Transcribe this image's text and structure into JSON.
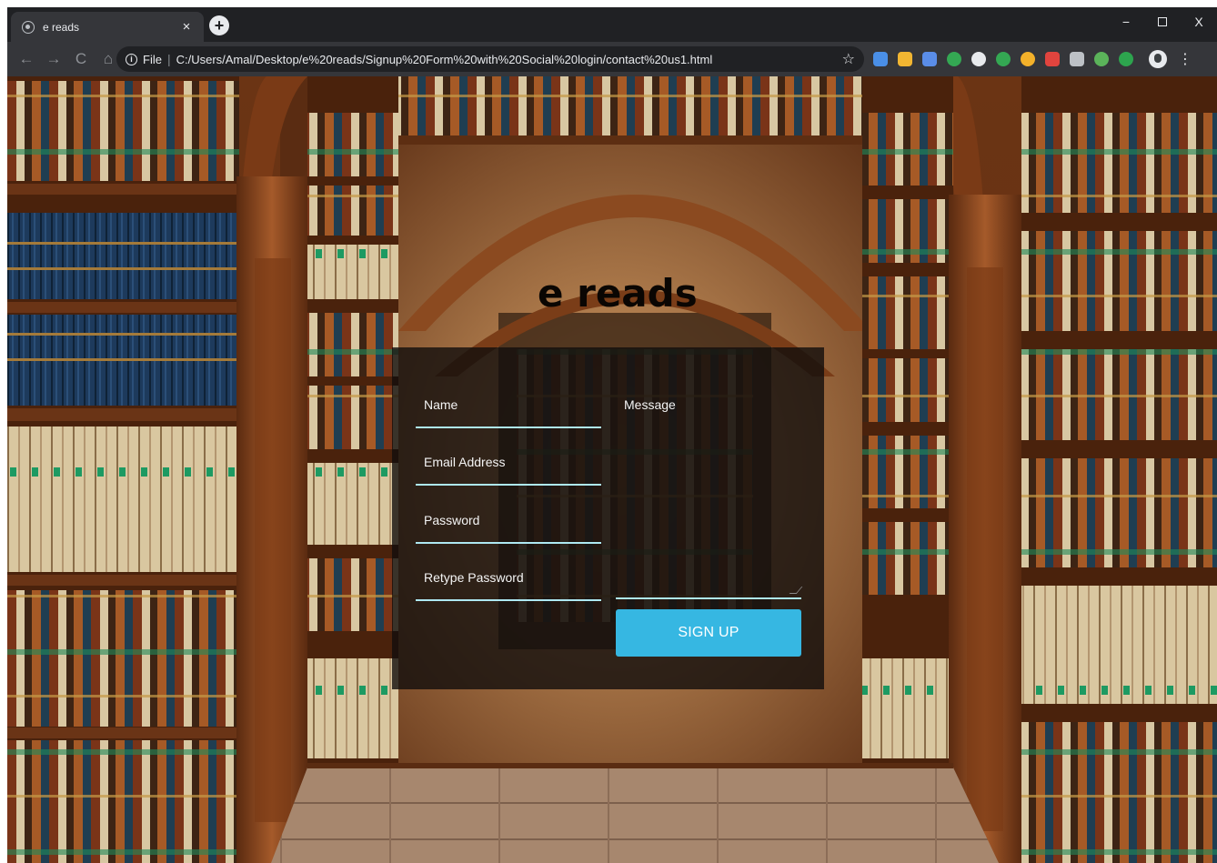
{
  "browser": {
    "tab": {
      "title": "e reads"
    },
    "address_bar": {
      "scheme": "File",
      "separator": "|",
      "url": "C:/Users/Amal/Desktop/e%20reads/Signup%20Form%20with%20Social%20login/contact%20us1.html"
    },
    "icons": {
      "tab_close": "×",
      "new_tab": "+",
      "back": "←",
      "forward": "→",
      "reload": "C",
      "home": "⌂",
      "info": "i",
      "bookmark_star": "☆",
      "menu": "⋮",
      "minimize": "−",
      "close": "X"
    },
    "extension_colors": [
      "#4a8fe7",
      "#f2b632",
      "#5a8de8",
      "#34a853",
      "#e8eaed",
      "#34a853",
      "#f3b12a",
      "#e1443e",
      "#bdc1c6",
      "#5bb35a",
      "#2da44e"
    ]
  },
  "page": {
    "brand": "e reads",
    "form": {
      "name_label": "Name",
      "email_label": "Email Address",
      "password_label": "Password",
      "retype_password_label": "Retype Password",
      "message_label": "Message",
      "submit_label": "SIGN UP"
    },
    "colors": {
      "accent": "#36b7e2",
      "underline": "#aee8f2",
      "panel": "#120e0c"
    }
  }
}
